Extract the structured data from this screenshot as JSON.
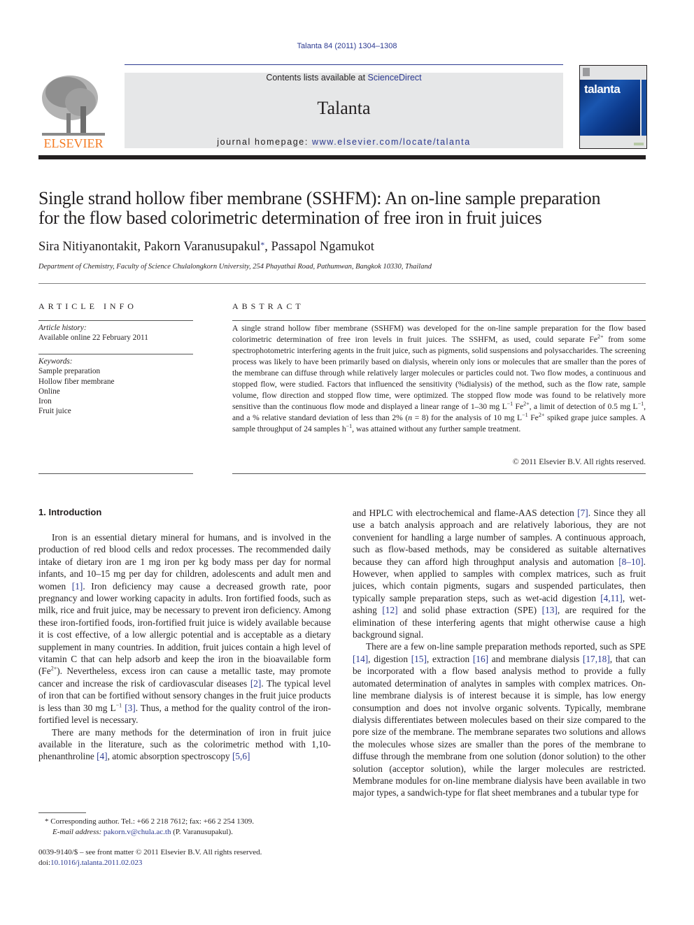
{
  "header": {
    "citation": "Talanta 84 (2011) 1304–1308",
    "contents_prefix": "Contents lists available at ",
    "contents_link": "ScienceDirect",
    "journal_name": "Talanta",
    "homepage_prefix": "journal homepage: ",
    "homepage_link": "www.elsevier.com/locate/talanta",
    "publisher_logo": "ELSEVIER",
    "cover_title": "talanta"
  },
  "article": {
    "title_line1": "Single strand hollow fiber membrane (SSHFM): An on-line sample preparation",
    "title_line2": "for the flow based colorimetric determination of free iron in fruit juices",
    "authors": [
      {
        "name": "Sira Nitiyanontakit",
        "sep": ", "
      },
      {
        "name": "Pakorn Varanusupakul",
        "mark": "*",
        "sep": ", "
      },
      {
        "name": "Passapol Ngamukot",
        "sep": ""
      }
    ],
    "affiliation": "Department of Chemistry, Faculty of Science Chulalongkorn University, 254 Phayathai Road, Pathumwan, Bangkok 10330, Thailand"
  },
  "article_info": {
    "label": "ARTICLE INFO",
    "history_label": "Article history:",
    "history_value": "Available online 22 February 2011",
    "keywords_label": "Keywords:",
    "keywords": [
      "Sample preparation",
      "Hollow fiber membrane",
      "Online",
      "Iron",
      "Fruit juice"
    ]
  },
  "abstract": {
    "label": "ABSTRACT",
    "text_1": "A single strand hollow fiber membrane (SSHFM) was developed for the on-line sample preparation for the flow based colorimetric determination of free iron levels in fruit juices. The SSHFM, as used, could separate Fe",
    "sup_1": "2+",
    "text_2": " from some spectrophotometric interfering agents in the fruit juice, such as pigments, solid suspensions and polysaccharides. The screening process was likely to have been primarily based on dialysis, wherein only ions or molecules that are smaller than the pores of the membrane can diffuse through while relatively larger molecules or particles could not. Two flow modes, a continuous and stopped flow, were studied. Factors that influenced the sensitivity (%dialysis) of the method, such as the flow rate, sample volume, flow direction and stopped flow time, were optimized. The stopped flow mode was found to be relatively more sensitive than the continuous flow mode and displayed a linear range of 1–30 mg L",
    "sup_2": "−1",
    "text_3": " Fe",
    "sup_3": "2+",
    "text_4": ", a limit of detection of 0.5 mg L",
    "sup_4": "−1",
    "text_5": ", and a % relative standard deviation of less than 2% (",
    "n_italic": "n",
    "text_6": " = 8) for the analysis of 10 mg L",
    "sup_6": "−1",
    "text_7": " Fe",
    "sup_7": "2+",
    "text_8": " spiked grape juice samples. A sample throughput of 24 samples h",
    "sup_8": "−1",
    "text_9": ", was attained without any further sample treatment.",
    "copyright": "© 2011 Elsevier B.V. All rights reserved."
  },
  "introduction": {
    "heading": "1.  Introduction",
    "p1": [
      {
        "t": "Iron is an essential dietary mineral for humans, and is involved in the production of red blood cells and redox processes. The recommended daily intake of dietary iron are 1 mg iron per kg body mass per day for normal infants, and 10–15 mg per day for children, adolescents and adult men and women "
      },
      {
        "ref": "[1]"
      },
      {
        "t": ". Iron deficiency may cause a decreased growth rate, poor pregnancy and lower working capacity in adults. Iron fortified foods, such as milk, rice and fruit juice, may be necessary to prevent iron deficiency. Among these iron-fortified foods, iron-fortified fruit juice is widely available because it is cost effective, of a low allergic potential and is acceptable as a dietary supplement in many countries. In addition, fruit juices contain a high level of vitamin C that can help adsorb and keep the iron in the bioavailable form (Fe"
      },
      {
        "sup": "2+"
      },
      {
        "t": "). Nevertheless, excess iron can cause a metallic taste, may promote cancer and increase the risk of cardiovascular diseases "
      },
      {
        "ref": "[2]"
      },
      {
        "t": ". The typical level of iron that can be fortified without sensory changes in the fruit juice products is less than 30 mg L"
      },
      {
        "sup": "−1"
      },
      {
        "t": " "
      },
      {
        "ref": "[3]"
      },
      {
        "t": ". Thus, a method for the quality control of the iron-fortified level is necessary."
      }
    ],
    "p2": [
      {
        "t": "There are many methods for the determination of iron in fruit juice available in the literature, such as the colorimetric method with 1,10-phenanthroline "
      },
      {
        "ref": "[4]"
      },
      {
        "t": ", atomic absorption spectroscopy "
      },
      {
        "ref": "[5,6]"
      },
      {
        "t": " and HPLC with electrochemical and flame-AAS detection "
      },
      {
        "ref": "[7]"
      },
      {
        "t": ". Since they all use a batch analysis approach and are relatively laborious, they are not convenient for handling a large number of samples. A continuous approach, such as flow-based methods, may be considered as suitable alternatives because they can afford high throughput analysis and automation "
      },
      {
        "ref": "[8–10]"
      },
      {
        "t": ". However, when applied to samples with complex matrices, such as fruit juices, which contain pigments, sugars and suspended particulates, then typically sample preparation steps, such as wet-acid digestion "
      },
      {
        "ref": "[4,11]"
      },
      {
        "t": ", wet-ashing "
      },
      {
        "ref": "[12]"
      },
      {
        "t": " and solid phase extraction (SPE) "
      },
      {
        "ref": "[13]"
      },
      {
        "t": ", are required for the elimination of these interfering agents that might otherwise cause a high background signal."
      }
    ],
    "p3": [
      {
        "t": "There are a few on-line sample preparation methods reported, such as SPE "
      },
      {
        "ref": "[14]"
      },
      {
        "t": ", digestion "
      },
      {
        "ref": "[15]"
      },
      {
        "t": ", extraction "
      },
      {
        "ref": "[16]"
      },
      {
        "t": " and membrane dialysis "
      },
      {
        "ref": "[17,18]"
      },
      {
        "t": ", that can be incorporated with a flow based analysis method to provide a fully automated determination of analytes in samples with complex matrices. On-line membrane dialysis is of interest because it is simple, has low energy consumption and does not involve organic solvents. Typically, membrane dialysis differentiates between molecules based on their size compared to the pore size of the membrane. The membrane separates two solutions and allows the molecules whose sizes are smaller than the pores of the membrane to diffuse through the membrane from one solution (donor solution) to the other solution (acceptor solution), while the larger molecules are restricted. Membrane modules for on-line membrane dialysis have been available in two major types, a sandwich-type for flat sheet membranes and a tubular type for"
      }
    ]
  },
  "footnotes": {
    "corresponding": "* Corresponding author. Tel.: +66 2 218 7612; fax: +66 2 254 1309.",
    "email_label": "E-mail address:",
    "email": "pakorn.v@chula.ac.th",
    "email_suffix": " (P. Varanusupakul).",
    "front_matter": "0039-9140/$ – see front matter © 2011 Elsevier B.V. All rights reserved.",
    "doi_prefix": "doi:",
    "doi": "10.1016/j.talanta.2011.02.023"
  }
}
